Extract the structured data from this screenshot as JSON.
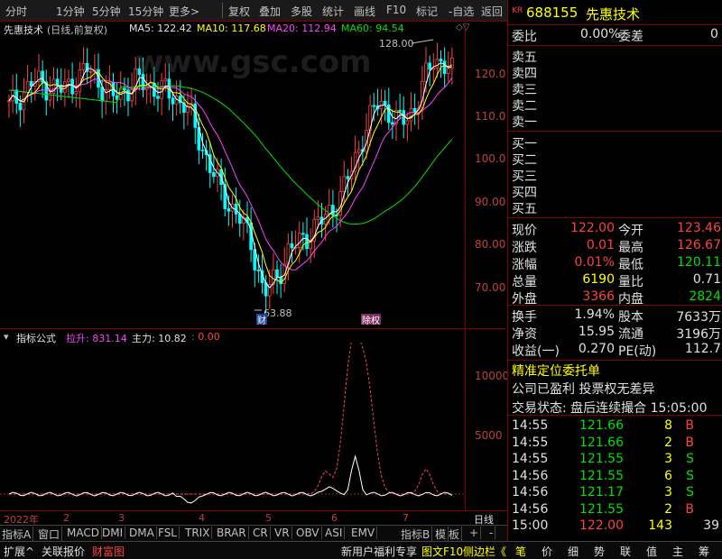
{
  "toolbar": {
    "items": [
      "分时",
      "1分钟",
      "5分钟",
      "15分钟",
      "更多>",
      "复权",
      "叠加",
      "多股",
      "统计",
      "画线",
      "F10",
      "标记",
      "-自选",
      "返回"
    ]
  },
  "info": {
    "name": "先惠技术",
    "mode": "(日线,前复权)",
    "ma5": "MA5: 122.42",
    "ma10": "MA10: 117.68",
    "ma20": "MA20: 112.94",
    "ma60": "MA60: 94.54"
  },
  "watermark": "www.gsc.com",
  "chart": {
    "high_label": "128.00",
    "low_label": "63.88",
    "marker1": "财",
    "marker2": "除权"
  },
  "yaxis": [
    "120.0",
    "110.0",
    "100.0",
    "90.00",
    "80.00",
    "70.00"
  ],
  "indicator": {
    "title": "指标公式",
    "lashen": "拉升: 831.14",
    "zhuli": "主力: 10.82",
    "val": ": 0.00",
    "yaxis": [
      "10000",
      "5000"
    ]
  },
  "dates": {
    "year": "2022年",
    "months": [
      "2",
      "3",
      "4",
      "5",
      "6",
      "7"
    ],
    "period": "日线"
  },
  "tabs": [
    "指标A",
    "窗口",
    "MACD",
    "DMI",
    "DMA",
    "FSL",
    "TRIX",
    "BRAR",
    "CR",
    "VR",
    "OBV",
    "ASI",
    "EMV",
    "指标B",
    "模",
    "板",
    "+",
    "-"
  ],
  "bottom": {
    "left": [
      "扩展^",
      "关联报价",
      "财富图"
    ],
    "middle": [
      "新用户福利专享",
      "图文F10",
      "侧边栏《"
    ],
    "right": [
      "笔",
      "价",
      "细",
      "势",
      "联",
      "值",
      "主",
      "筹"
    ]
  },
  "quote": {
    "code": "688155",
    "name": "先惠技术",
    "badge": "KR",
    "weibi_label": "委比",
    "weibi": "0.00%",
    "weicha_label": "委差",
    "weicha": "0",
    "sell": [
      "卖五",
      "卖四",
      "卖三",
      "卖二",
      "卖一"
    ],
    "buy": [
      "买一",
      "买二",
      "买三",
      "买四",
      "买五"
    ],
    "rows": [
      [
        "现价",
        "122.00",
        "今开",
        "123.46"
      ],
      [
        "涨跌",
        "0.01",
        "最高",
        "126.67"
      ],
      [
        "涨幅",
        "0.01%",
        "最低",
        "120.11"
      ],
      [
        "总量",
        "6190",
        "量比",
        "0.71"
      ],
      [
        "外盘",
        "3366",
        "内盘",
        "2824"
      ]
    ],
    "rows2": [
      [
        "换手",
        "1.94%",
        "股本",
        "7633万"
      ],
      [
        "净资",
        "15.95",
        "流通",
        "3196万"
      ],
      [
        "收益(一)",
        "0.270",
        "PE(动)",
        "112.7"
      ]
    ],
    "jingzhun": "精准定位委托单",
    "company": "公司已盈利 投票权无差异",
    "status": "交易状态: 盘后连续撮合 15:05:00",
    "ticks": [
      [
        "14:55",
        "121.66",
        "8",
        "B"
      ],
      [
        "14:55",
        "121.66",
        "2",
        "B"
      ],
      [
        "14:55",
        "121.55",
        "3",
        "S"
      ],
      [
        "14:56",
        "121.55",
        "6",
        "S"
      ],
      [
        "14:56",
        "121.17",
        "3",
        "S"
      ],
      [
        "14:56",
        "121.55",
        "2",
        "B"
      ],
      [
        "15:00",
        "122.00",
        "143",
        "39"
      ]
    ]
  },
  "colors": {
    "up": "#ff4040",
    "down": "#00ffff",
    "ma5": "#ffffff",
    "ma10": "#ffff00",
    "ma20": "#ff40ff",
    "ma60": "#00e000"
  }
}
